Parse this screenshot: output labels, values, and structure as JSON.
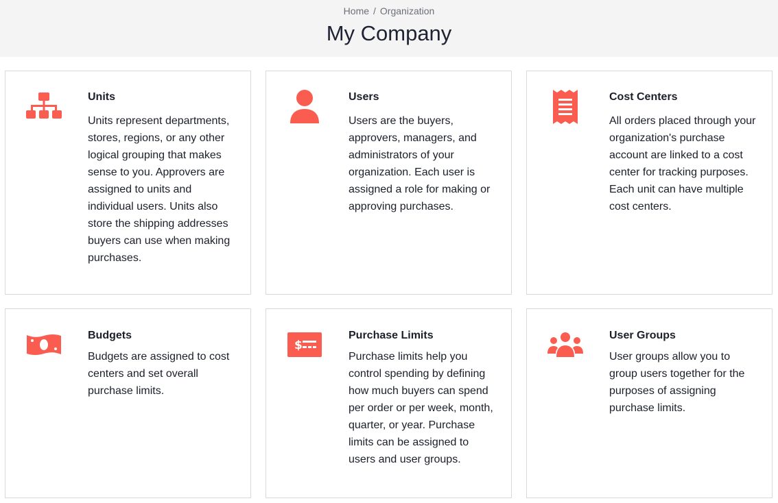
{
  "breadcrumb": {
    "home": "Home",
    "separator": "/",
    "current": "Organization"
  },
  "page": {
    "title": "My Company"
  },
  "theme": {
    "accent": "#fa5d4f",
    "header_bg": "#f4f4f4",
    "border": "#d9d9d9"
  },
  "cards": [
    {
      "icon": "hierarchy-icon",
      "title": "Units",
      "description": "Units represent departments, stores, regions, or any other logical grouping that makes sense to you. Approvers are assigned to units and individual users. Units also store the shipping addresses buyers can use when making purchases."
    },
    {
      "icon": "user-icon",
      "title": "Users",
      "description": "Users are the buyers, approvers, managers, and administrators of your organization. Each user is assigned a role for making or approving purchases."
    },
    {
      "icon": "receipt-icon",
      "title": "Cost Centers",
      "description": "All orders placed through your organization's purchase account are linked to a cost center for tracking purposes. Each unit can have multiple cost centers."
    },
    {
      "icon": "money-bill-icon",
      "title": "Budgets",
      "description": "Budgets are assigned to cost centers and set overall purchase limits."
    },
    {
      "icon": "money-check-icon",
      "title": "Purchase Limits",
      "description": "Purchase limits help you control spending by defining how much buyers can spend per order or per week, month, quarter, or year. Purchase limits can be assigned to users and user groups."
    },
    {
      "icon": "users-group-icon",
      "title": "User Groups",
      "description": "User groups allow you to group users together for the purposes of assigning purchase limits."
    }
  ]
}
